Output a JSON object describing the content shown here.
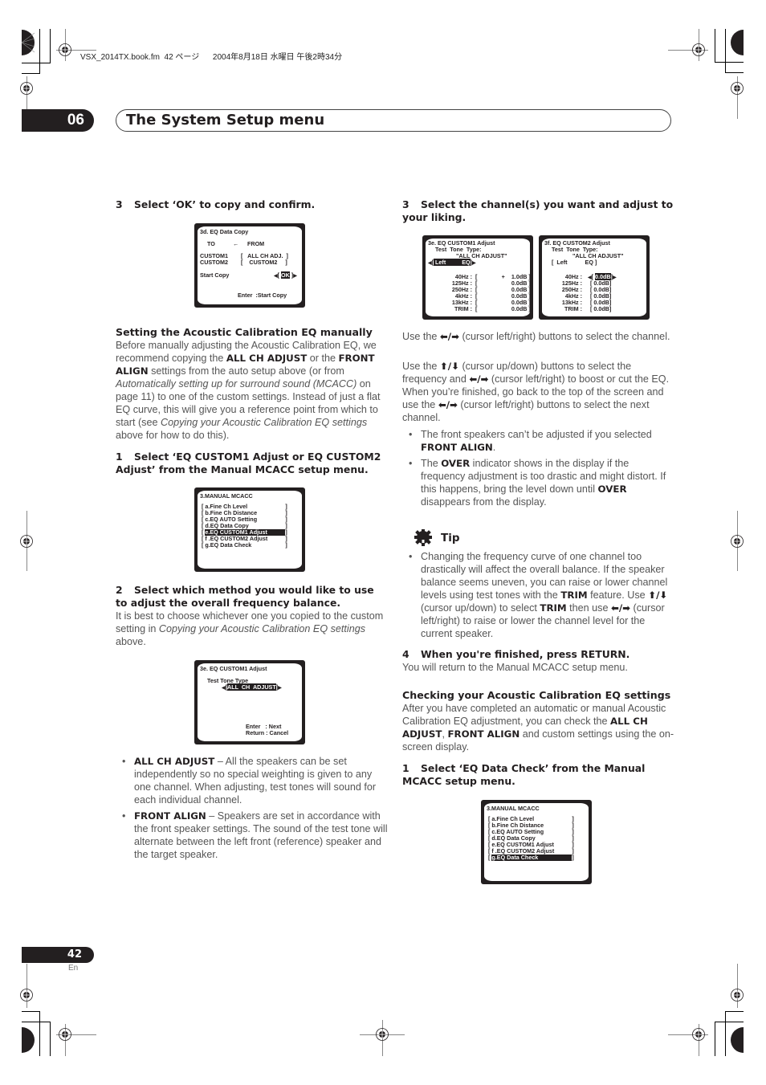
{
  "print_meta": {
    "file": "VSX_2014TX.book.fm",
    "page_ref": "42",
    "page_word": "ページ",
    "timestamp": "2004年8月18日 水曜日 午後2時34分"
  },
  "chapter": {
    "number": "06",
    "title": "The System Setup menu"
  },
  "left_column": {
    "step3": {
      "num": "3",
      "text": "Select ‘OK’ to copy and confirm."
    },
    "osd_copy": {
      "title": "3d. EQ Data Copy",
      "to_label": "TO",
      "arrow": "←",
      "from_label": "FROM",
      "rows": [
        {
          "to": "CUSTOM1",
          "from": "ALL CH ADJ."
        },
        {
          "to": "CUSTOM2",
          "from": "CUSTOM2"
        }
      ],
      "start_label": "Start Copy",
      "ok_label": "OK",
      "footer": "Enter  :Start Copy"
    },
    "section_manual": {
      "heading": "Setting the Acoustic Calibration EQ manually",
      "p1_a": "Before manually adjusting the Acoustic Calibration EQ, we recommend copying the ",
      "p1_b": "ALL CH ADJUST",
      "p1_c": " or the ",
      "p1_d": "FRONT ALIGN",
      "p1_e": " settings from the auto setup above (or from ",
      "p1_f": "Automatically setting up for surround sound (MCACC)",
      "p1_g": " on page 11) to one of the custom settings. Instead of just a flat EQ curve, this will give you a reference point from which to start (see ",
      "p1_h": "Copying your Acoustic Calibration EQ settings",
      "p1_i": " above for how to do this)."
    },
    "step1": {
      "num": "1",
      "text": "Select ‘EQ CUSTOM1 Adjust or EQ CUSTOM2 Adjust’ from the Manual MCACC setup menu."
    },
    "osd_menu1": {
      "title": "3.MANUAL MCACC",
      "items": [
        "a.Fine Ch Level",
        "b.Fine Ch Distance",
        "c.EQ AUTO Setting",
        "d.EQ Data Copy",
        "e.EQ CUSTOM1 Adjust",
        "f .EQ CUSTOM2 Adjust",
        "g.EQ Data Check"
      ],
      "selected_index": 4
    },
    "step2": {
      "num": "2",
      "text": "Select which method you would like to use to adjust the overall frequency balance."
    },
    "step2_body_a": "It is best to choose whichever one you copied to the custom setting in ",
    "step2_body_b": "Copying your Acoustic Calibration EQ settings",
    "step2_body_c": " above.",
    "osd_custom1": {
      "title": "3e. EQ CUSTOM1 Adjust",
      "label": "Test Tone Type",
      "value": "ALL  CH  ADJUST",
      "footer1": "Enter   : Next",
      "footer2": "Return : Cancel"
    },
    "bullets": [
      {
        "term": "ALL CH ADJUST",
        "text": " – All the speakers can be set independently so no special weighting is given to any one channel. When adjusting, test tones will sound for each individual channel."
      },
      {
        "term": "FRONT ALIGN",
        "text": " – Speakers are set in accordance with the front speaker settings. The sound of the test tone will alternate between the left front (reference) speaker and the target speaker."
      }
    ]
  },
  "right_column": {
    "step3": {
      "num": "3",
      "text": "Select the channel(s) you want and adjust to your liking."
    },
    "osd_eq1": {
      "title": "3e. EQ CUSTOM1 Adjust",
      "line2": "Test  Tone  Type:",
      "line3": "\"ALL CH ADJUST\"",
      "channel": "Left",
      "channel_suffix": "EQ",
      "bands": [
        {
          "label": "40Hz :",
          "value": "+    1.0dB"
        },
        {
          "label": "125Hz :",
          "value": "0.0dB"
        },
        {
          "label": "250Hz :",
          "value": "0.0dB"
        },
        {
          "label": "4kHz :",
          "value": "0.0dB"
        },
        {
          "label": "13kHz :",
          "value": "0.0dB"
        },
        {
          "label": "TRIM :",
          "value": "0.0dB"
        }
      ]
    },
    "osd_eq2": {
      "title": "3f. EQ CUSTOM2 Adjust",
      "line2": "Test  Tone  Type:",
      "line3": "\"ALL CH ADJUST\"",
      "channel": "Left",
      "channel_suffix": "EQ",
      "bands": [
        {
          "label": "40Hz :",
          "value": "0.0dB"
        },
        {
          "label": "125Hz :",
          "value": "0.0dB"
        },
        {
          "label": "250Hz :",
          "value": "0.0dB"
        },
        {
          "label": "4kHz :",
          "value": "0.0dB"
        },
        {
          "label": "13kHz :",
          "value": "0.0dB"
        },
        {
          "label": "TRIM :",
          "value": "0.0dB"
        }
      ]
    },
    "para1_a": "Use the ",
    "para1_arrows": "⬅/➡",
    "para1_b": " (cursor left/right) buttons to select the channel.",
    "para2_a": "Use the ",
    "para2_arrows_ud": "⬆/⬇",
    "para2_b": " (cursor up/down) buttons to select the frequency and ",
    "para2_arrows_lr": "⬅/➡",
    "para2_c": " (cursor left/right) to boost or cut the EQ. When you’re finished, go back to the top of the screen and use the ",
    "para2_d": " (cursor left/right) buttons to select the next channel.",
    "bullets": [
      {
        "a": "The front speakers can’t be adjusted if you selected ",
        "b": "FRONT ALIGN",
        "c": "."
      },
      {
        "a": "The ",
        "b": "OVER",
        "c": " indicator shows in the display if the frequency adjustment is too drastic and might distort. If this happens, bring the level down until ",
        "d": "OVER",
        "e": " disappears from the display."
      }
    ],
    "tip": {
      "label": "Tip",
      "a": "Changing the frequency curve of one channel too drastically will affect the overall balance. If the speaker balance seems uneven, you can raise or lower channel levels using test tones with the ",
      "b": "TRIM",
      "c": " feature. Use ",
      "d": " (cursor up/down) to select ",
      "e": "TRIM",
      "f": " then use ",
      "g": " (cursor left/right) to raise or lower the channel level for the current speaker."
    },
    "step4": {
      "num": "4",
      "text": "When you're finished, press RETURN."
    },
    "step4_body": "You will return to the Manual MCACC setup menu.",
    "section_check": {
      "heading": "Checking your Acoustic Calibration EQ settings",
      "a": "After you have completed an automatic or manual Acoustic Calibration EQ adjustment, you can check the ",
      "b": "ALL CH ADJUST",
      "c": ", ",
      "d": "FRONT ALIGN",
      "e": " and custom settings using the on-screen display."
    },
    "step1": {
      "num": "1",
      "text": "Select ‘EQ Data Check’ from the Manual MCACC setup menu."
    },
    "osd_menu2": {
      "title": "3.MANUAL MCACC",
      "items": [
        "a.Fine Ch Level",
        "b.Fine Ch Distance",
        "c.EQ AUTO Setting",
        "d.EQ Data Copy",
        "e.EQ CUSTOM1 Adjust",
        "f .EQ CUSTOM2 Adjust",
        "g.EQ Data Check"
      ],
      "selected_index": 6
    }
  },
  "footer": {
    "page_number": "42",
    "language": "En"
  }
}
